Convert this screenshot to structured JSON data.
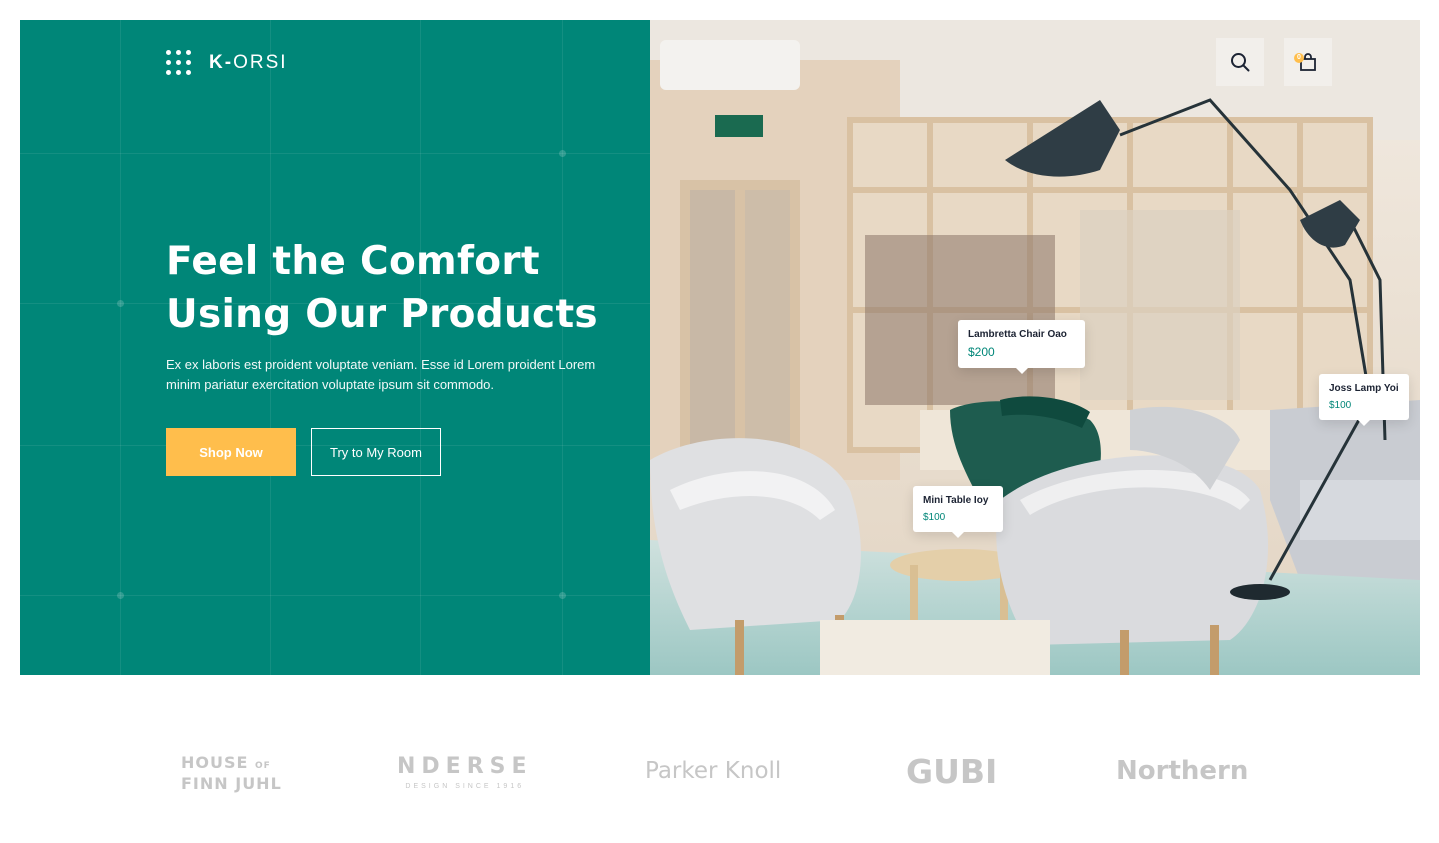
{
  "logo": {
    "mark_icon": "dots-grid-icon",
    "text_bold": "K-",
    "text_light": "ORSI"
  },
  "hero": {
    "headline_line1": "Feel the Comfort",
    "headline_line2": "Using Our Products",
    "subtext": "Ex ex laboris est proident voluptate veniam. Esse id Lorem proident Lorem minim pariatur exercitation voluptate ipsum sit commodo.",
    "primary_button": "Shop Now",
    "secondary_button": "Try to My Room",
    "background_color": "#008678",
    "accent_color": "#FFBE4C"
  },
  "header_icons": {
    "search_icon": "search-icon",
    "cart_icon": "shopping-bag-icon",
    "cart_count": "0"
  },
  "product_tags": [
    {
      "name": "Lambretta Chair Oao",
      "price": "$200"
    },
    {
      "name": "Joss Lamp Yoi",
      "price": "$100"
    },
    {
      "name": "Mini Table Ioy",
      "price": "$100"
    }
  ],
  "brands": {
    "house_line1": "HOUSE",
    "house_of": "OF",
    "house_line2": "FINN JUHL",
    "nderse": "NDERSE",
    "nderse_sub": "DESIGN SINCE 1916",
    "parker": "Parker Knoll",
    "gubi": "GUBI",
    "northern": "Northern"
  }
}
